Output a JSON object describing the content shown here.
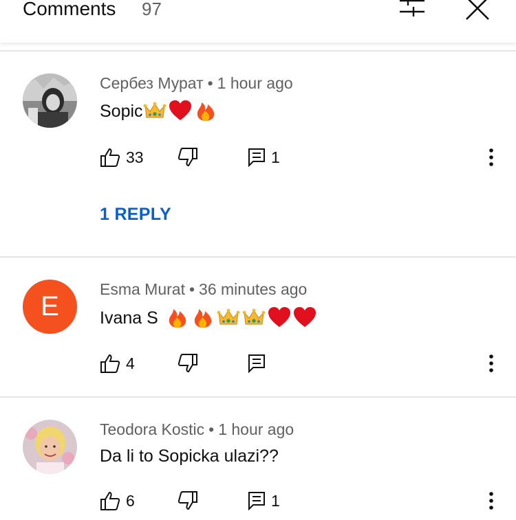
{
  "header": {
    "title": "Comments",
    "count": "97",
    "filter_icon": "filter-sort-icon",
    "close_icon": "close-icon"
  },
  "comments": [
    {
      "author": "Сербез Мурат",
      "separator": "•",
      "time": "1 hour ago",
      "text": "Sopic",
      "emojis": [
        "crown",
        "red-heart",
        "fire"
      ],
      "likes": "33",
      "replies": "1",
      "replies_link": "1 REPLY",
      "avatar": "photo"
    },
    {
      "author": "Esma Murat",
      "separator": "•",
      "time": "36 minutes ago",
      "text": "Ivana S ",
      "emojis": [
        "fire",
        "fire",
        "crown",
        "crown",
        "red-heart",
        "red-heart"
      ],
      "likes": "4",
      "replies": "",
      "avatar_letter": "E",
      "avatar_color": "#f4511e"
    },
    {
      "author": "Teodora Kostic",
      "separator": "•",
      "time": "1 hour ago",
      "text": "Da li to Sopicka ulazi??",
      "emojis": [],
      "likes": "6",
      "replies": "1",
      "avatar": "photo"
    }
  ],
  "colors": {
    "link": "#065fd4",
    "meta": "#606060",
    "divider": "#e6e6e6"
  }
}
